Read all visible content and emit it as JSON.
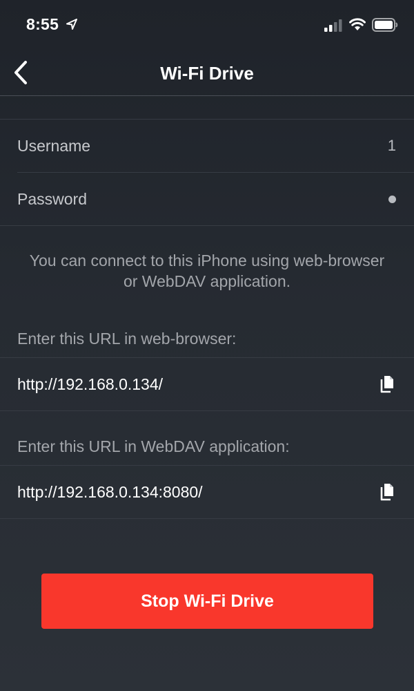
{
  "status_bar": {
    "time": "8:55",
    "icons": [
      "location-arrow-icon",
      "cellular-signal-icon",
      "wifi-icon",
      "battery-icon"
    ]
  },
  "nav": {
    "title": "Wi-Fi Drive",
    "back_icon": "chevron-left-icon"
  },
  "credentials": {
    "username_label": "Username",
    "username_value": "1",
    "password_label": "Password"
  },
  "info": {
    "text": "You can connect to this iPhone using web-browser or WebDAV application."
  },
  "browser": {
    "header": "Enter this URL in web-browser:",
    "url": "http://192.168.0.134/"
  },
  "webdav": {
    "header": "Enter this URL in WebDAV application:",
    "url": "http://192.168.0.134:8080/"
  },
  "actions": {
    "stop_label": "Stop Wi-Fi Drive"
  },
  "colors": {
    "background": "#23272e",
    "accent_red": "#f9372c",
    "secondary_text": "#a3a6ab"
  }
}
